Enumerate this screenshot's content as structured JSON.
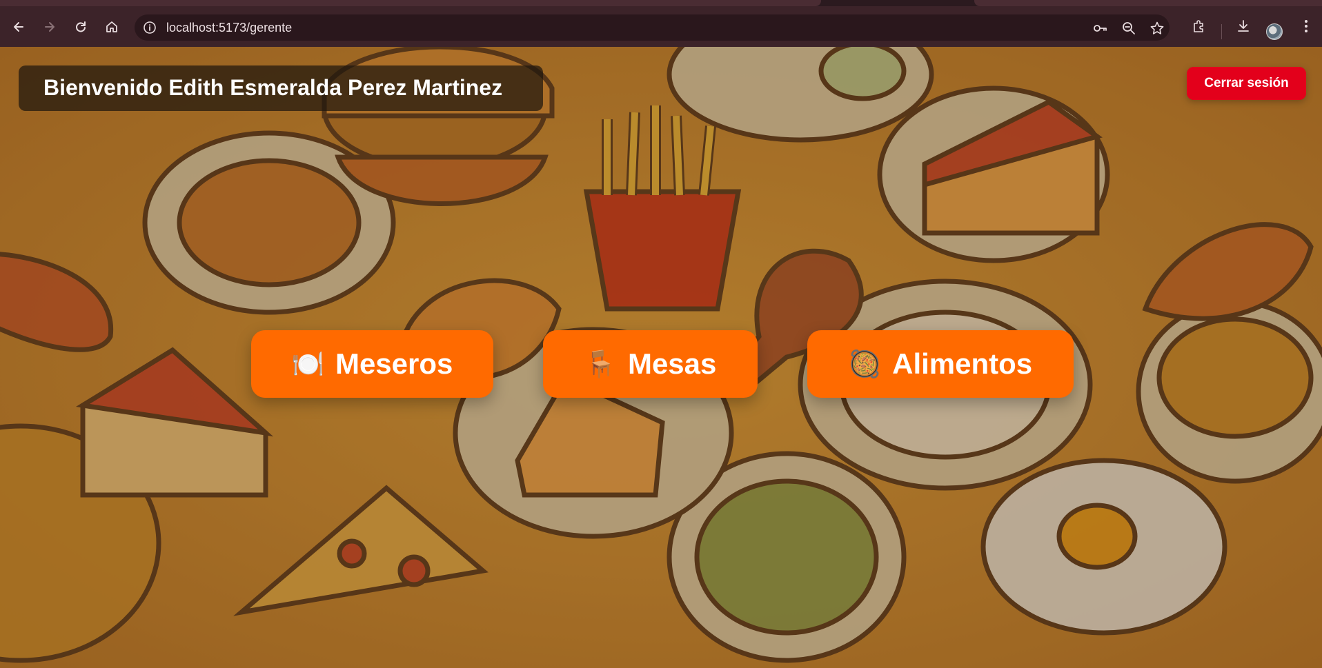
{
  "browser": {
    "url": "localhost:5173/gerente",
    "icons": [
      "back-icon",
      "forward-icon",
      "reload-icon",
      "home-icon",
      "site-info-icon",
      "key-icon",
      "zoom-icon",
      "star-icon",
      "extensions-icon",
      "download-icon",
      "profile-avatar",
      "menu-dots-icon"
    ]
  },
  "header": {
    "welcome": "Bienvenido Edith Esmeralda Perez Martinez",
    "logout_label": "Cerrar sesión"
  },
  "menu": {
    "meseros": {
      "emoji": "🍽️",
      "label": "Meseros"
    },
    "mesas": {
      "emoji": "🪑",
      "label": "Mesas"
    },
    "alimentos": {
      "emoji": "🥘",
      "label": "Alimentos"
    }
  },
  "colors": {
    "accent": "#ff6a00",
    "logout": "#e3001b",
    "background": "#c98a2c",
    "chrome": "#3c2329"
  }
}
